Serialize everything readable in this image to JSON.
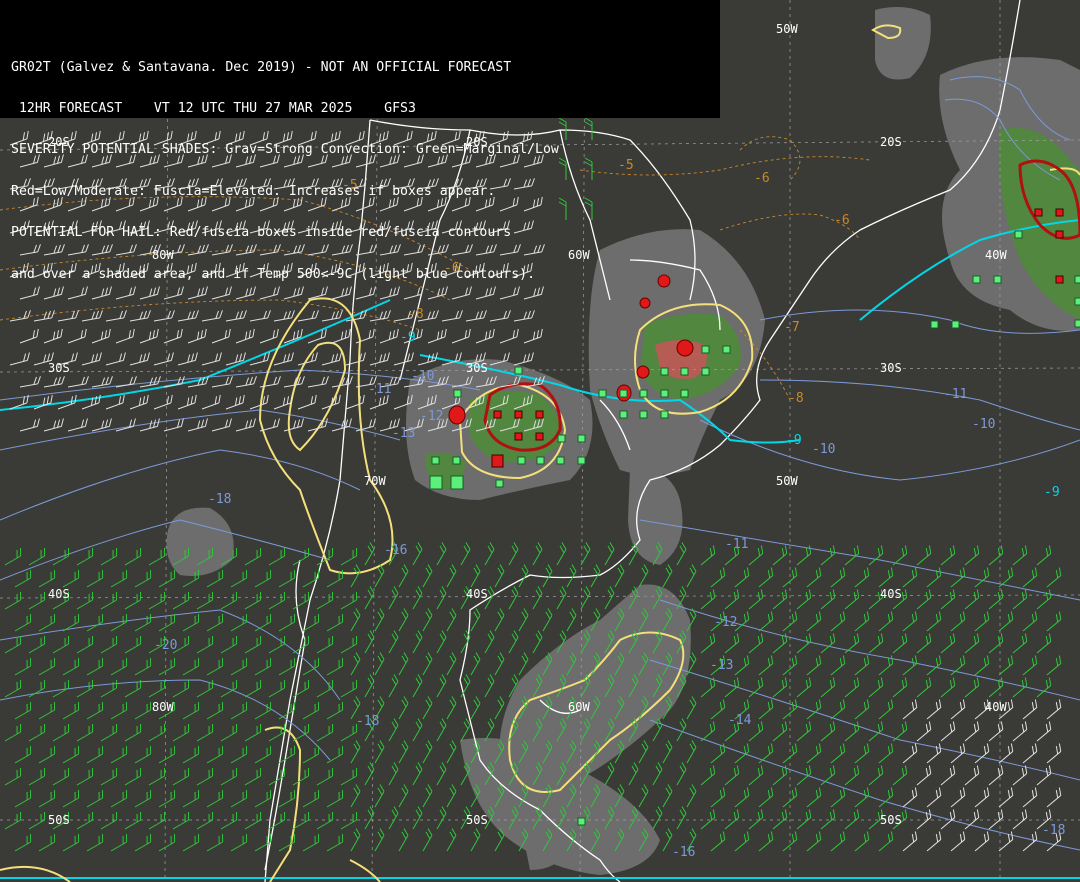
{
  "header": {
    "lines": [
      "GR02T (Galvez & Santavana. Dec 2019) - NOT AN OFFICIAL FORECAST",
      " 12HR FORECAST    VT 12 UTC THU 27 MAR 2025    GFS3",
      "SEVERITY POTENTIAL SHADES: Grav=Strong Convection: Green=Marginal/Low",
      "Red=Low/Moderate: Fuscia=Elevated. Increases if boxes appear.",
      "POTENTIAL FOR HAIL: Red/fuscia boxes inside red/fuscia contours",
      "and over a shaded area, and if Temp 500<-9C (light blue contours)."
    ]
  },
  "grid_labels": {
    "lat_20s_a": "20S",
    "lat_20s_b": "20S",
    "lat_20s_c": "20S",
    "lat_30s_a": "30S",
    "lat_30s_b": "30S",
    "lat_30s_c": "30S",
    "lat_40s_a": "40S",
    "lat_40s_b": "40S",
    "lat_40s_c": "40S",
    "lat_50s_a": "50S",
    "lat_50s_b": "50S",
    "lat_50s_c": "50S",
    "lon_80w_a": "80W",
    "lon_80w_b": "80W",
    "lon_70w": "70W",
    "lon_60w_a": "60W",
    "lon_60w_b": "60W",
    "lon_50w_a": "50W",
    "lon_50w_b": "50W",
    "lon_40w_a": "40W",
    "lon_40w_b": "40W"
  },
  "isotherm_labels": {
    "t_m5_a": "-5",
    "t_m5_b": "-5",
    "t_m6_a": "-6",
    "t_m6_b": "-6",
    "t_m6_c": "-6",
    "t_m7": "-7",
    "t_m8_a": "-8",
    "t_m8_b": "-8",
    "t_m9_a": "-9",
    "t_m9_b": "-9",
    "t_m9_c": "-9",
    "t_m10_a": "-10",
    "t_m10_b": "-10",
    "t_m10_c": "-10",
    "t_m11_a": "-11",
    "t_m11_b": "-11",
    "t_m11_c": "-11",
    "t_m12_a": "-12",
    "t_m12_b": "-12",
    "t_m13_a": "-13",
    "t_m13_b": "-13",
    "t_m14": "-14",
    "t_m16_a": "-16",
    "t_m16_b": "-16",
    "t_m18_a": "-18",
    "t_m18_b": "-18",
    "t_m18_c": "-18",
    "t_m20": "-20"
  },
  "colors": {
    "background": "#3a3a36",
    "shade_gray": "#7a7a7a",
    "shade_green": "#4e8a3a",
    "shade_red": "#c05050",
    "coast": "#ffffff",
    "contour_yellow": "#f4e07a",
    "contour_cyan": "#00d8e8",
    "isotherm_blue": "#7c9ad8",
    "isotherm_orange": "#c88a2a",
    "wind_green": "#2ec83a",
    "wind_white": "#e8e8e8",
    "box_green": "#5cf07a",
    "box_red": "#e01818",
    "hail_contour": "#cc0000"
  }
}
